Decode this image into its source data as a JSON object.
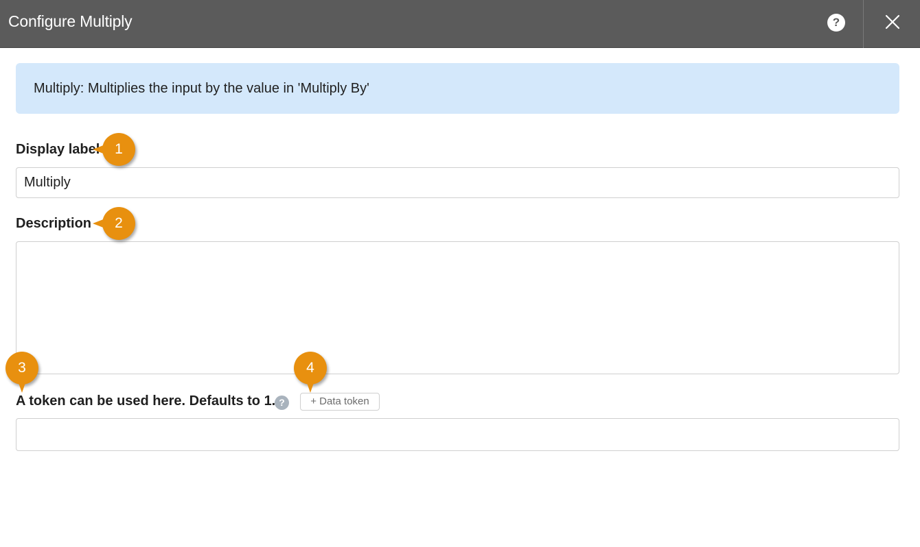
{
  "header": {
    "title": "Configure Multiply",
    "help_label": "?",
    "help_icon": "question-circle-icon",
    "close_icon": "close-x-icon"
  },
  "info": {
    "text": "Multiply: Multiplies the input by the value in 'Multiply By'"
  },
  "fields": {
    "display_label": {
      "label": "Display label",
      "value": "Multiply"
    },
    "description": {
      "label": "Description",
      "value": ""
    },
    "multiply_by": {
      "label": "A token can be used here. Defaults to 1.",
      "help_label": "?",
      "token_button": "+ Data token",
      "value": ""
    }
  },
  "markers": [
    "1",
    "2",
    "3",
    "4"
  ],
  "colors": {
    "header_bg": "#5b5b5b",
    "banner_bg": "#d4e8fb",
    "marker": "#e8900f",
    "help_badge": "#a9b3bd"
  }
}
